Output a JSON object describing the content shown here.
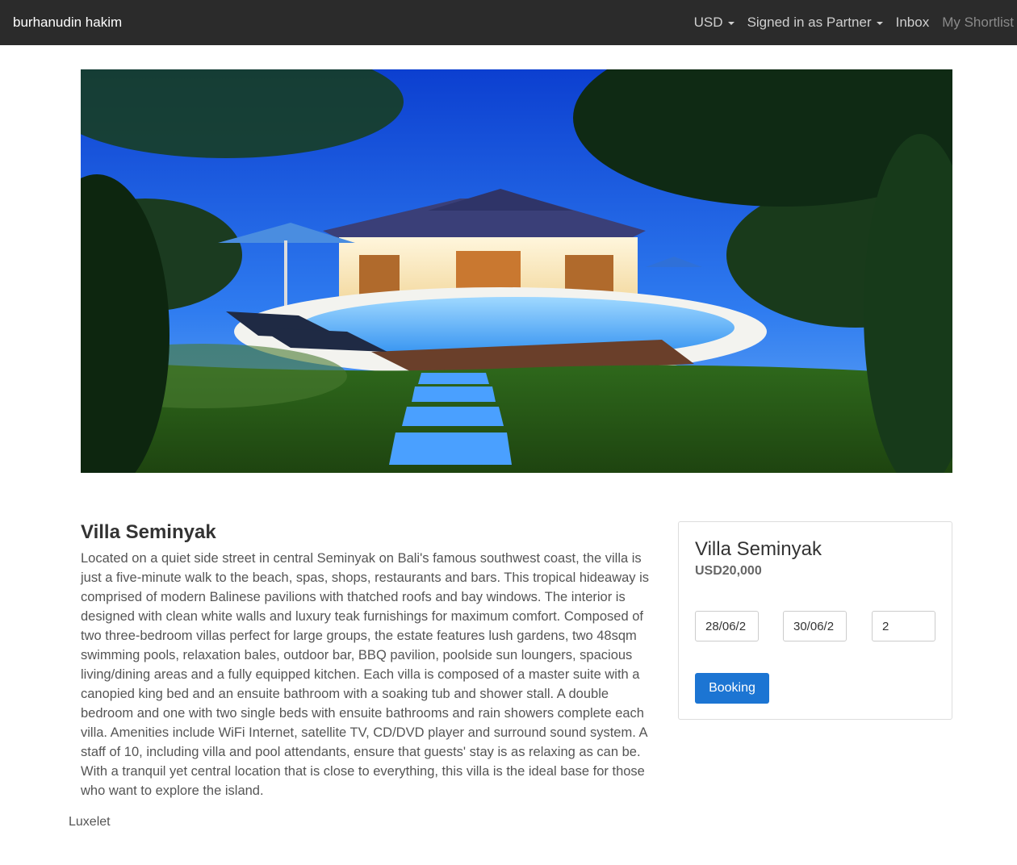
{
  "navbar": {
    "brand": "burhanudin hakim",
    "currency": "USD",
    "account": "Signed in as Partner",
    "inbox": "Inbox",
    "shortlist": "My Shortlist"
  },
  "listing": {
    "title": "Villa Seminyak",
    "description": "Located on a quiet side street in central Seminyak on Bali's famous southwest coast, the villa is just a five-minute walk to the beach, spas, shops, restaurants and bars. This tropical hideaway is comprised of modern Balinese pavilions with thatched roofs and bay windows. The interior is designed with clean white walls and luxury teak furnishings for maximum comfort. Composed of two three-bedroom villas perfect for large groups, the estate features lush gardens, two 48sqm swimming pools, relaxation bales, outdoor bar, BBQ pavilion, poolside sun loungers, spacious living/dining areas and a fully equipped kitchen. Each villa is composed of a master suite with a canopied king bed and an ensuite bathroom with a soaking tub and shower stall. A double bedroom and one with two single beds with ensuite bathrooms and rain showers complete each villa. Amenities include WiFi Internet, satellite TV, CD/DVD player and surround sound system. A staff of 10, including villa and pool attendants, ensure that guests' stay is as relaxing as can be. With a tranquil yet central location that is close to everything, this villa is the ideal base for those who want to explore the island."
  },
  "booking": {
    "title": "Villa Seminyak",
    "price": "USD20,000",
    "checkin": "28/06/2",
    "checkout": "30/06/2",
    "guests": "2",
    "button": "Booking"
  },
  "footer": {
    "text": "Luxelet"
  },
  "colors": {
    "navbar_bg": "#2b2b2b",
    "button_bg": "#1c75d3"
  }
}
